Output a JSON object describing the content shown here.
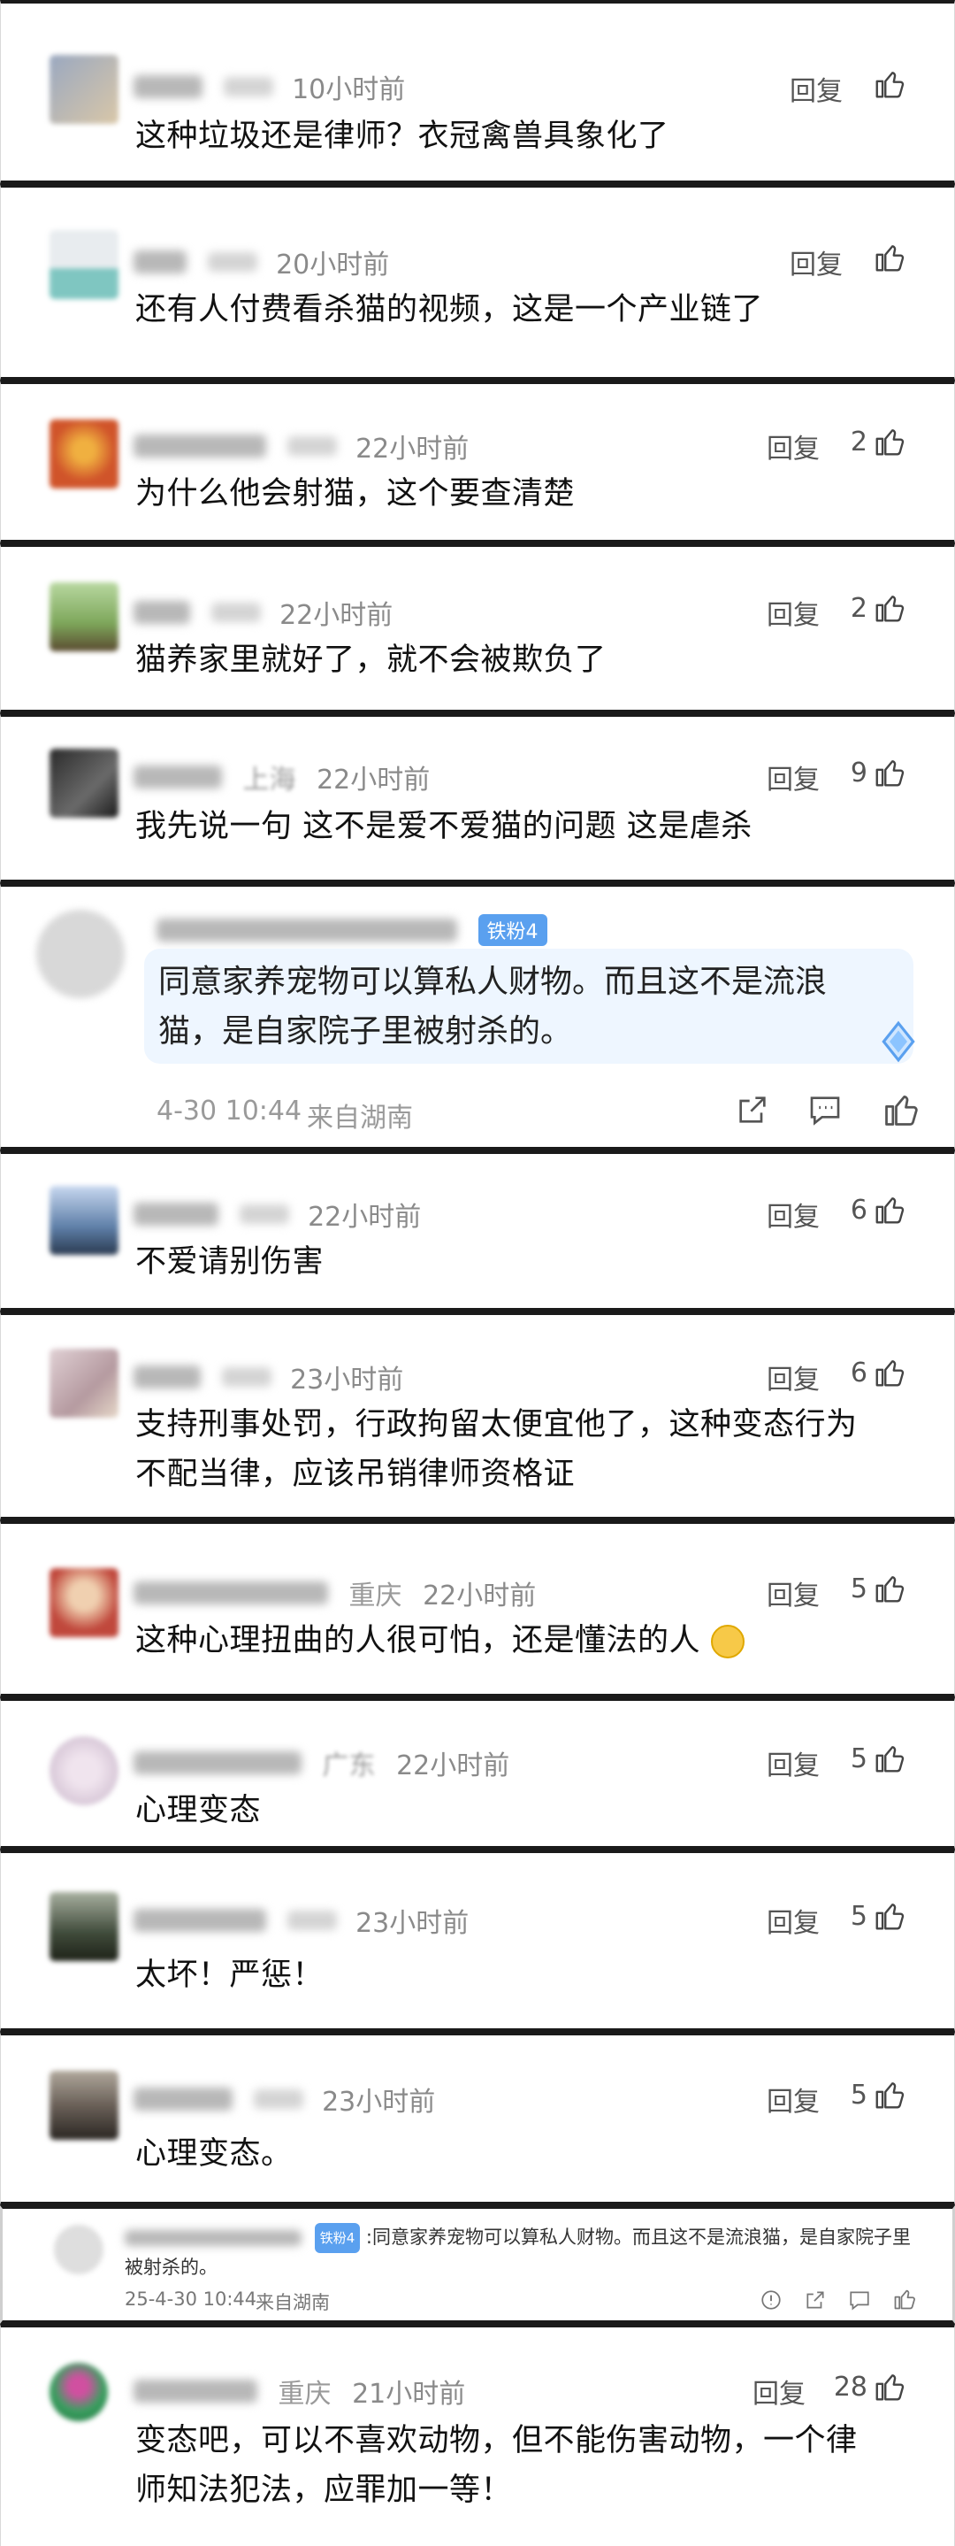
{
  "comments": [
    {
      "time": "10小时前",
      "location": "",
      "reply": "回复",
      "likes": "",
      "text": "这种垃圾还是律师？衣冠禽兽具象化了",
      "avatar_color": "#9aa8c0"
    },
    {
      "time": "20小时前",
      "location": "",
      "reply": "回复",
      "likes": "",
      "text": "还有人付费看杀猫的视频，这是一个产业链了",
      "avatar_color": "#7fc6c1"
    },
    {
      "time": "22小时前",
      "location": "",
      "reply": "回复",
      "likes": "2",
      "text": "为什么他会射猫，这个要查清楚",
      "avatar_color": "#d0542a"
    },
    {
      "time": "22小时前",
      "location": "",
      "reply": "回复",
      "likes": "2",
      "text": "猫养家里就好了，就不会被欺负了",
      "avatar_color": "#7da65a"
    },
    {
      "time": "22小时前",
      "location": "上海",
      "reply": "回复",
      "likes": "9",
      "text": "我先说一句 这不是爱不爱猫的问题 这是虐杀",
      "avatar_color": "#3a3a3a"
    },
    {
      "time": "22小时前",
      "location": "",
      "reply": "回复",
      "likes": "6",
      "text": "不爱请别伤害",
      "avatar_color": "#5e7fa8"
    },
    {
      "time": "23小时前",
      "location": "",
      "reply": "回复",
      "likes": "6",
      "text_lines": [
        "支持刑事处罚，行政拘留太便宜他了，这种变态行为",
        "不配当律，应该吊销律师资格证"
      ],
      "avatar_color": "#b59aa0"
    },
    {
      "time": "22小时前",
      "location": "重庆",
      "reply": "回复",
      "likes": "5",
      "text": "这种心理扭曲的人很可怕，还是懂法的人",
      "avatar_color": "#c0483c"
    },
    {
      "time": "22小时前",
      "location": "广东",
      "reply": "回复",
      "likes": "5",
      "text": "心理变态",
      "avatar_color": "#d8c8d8"
    },
    {
      "time": "23小时前",
      "location": "",
      "reply": "回复",
      "likes": "5",
      "text": "太坏！严惩！",
      "avatar_color": "#3f4a3a"
    },
    {
      "time": "23小时前",
      "location": "",
      "reply": "回复",
      "likes": "5",
      "text": "心理变态。",
      "avatar_color": "#6a6058"
    },
    {
      "time": "21小时前",
      "location": "重庆",
      "reply": "回复",
      "likes": "28",
      "text_lines": [
        "变态吧，可以不喜欢动物，但不能伤害动物，一个律",
        "师知法犯法，应罪加一等！"
      ],
      "avatar_color": "#3aa060"
    }
  ],
  "weibo_reply": {
    "badge": "铁粉4",
    "text_lines": [
      "同意家养宠物可以算私人财物。而且这不是流浪",
      "猫，是自家院子里被射杀的。"
    ],
    "date": "4-30 10:44",
    "source": "来自湖南"
  },
  "quote_reply": {
    "badge": "铁粉4",
    "text_lines": [
      ":同意家养宠物可以算私人财物。而且这不是流浪猫，是自家院子里",
      "被射杀的。"
    ],
    "date": "25-4-30 10:44",
    "source": "来自湖南"
  }
}
